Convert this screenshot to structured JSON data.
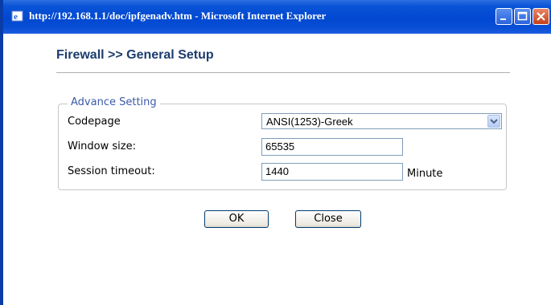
{
  "window": {
    "title": "http://192.168.1.1/doc/ipfgenadv.htm - Microsoft Internet Explorer",
    "icons": [
      "ie-icon",
      "minimize-icon",
      "maximize-icon",
      "close-icon"
    ]
  },
  "page": {
    "title": "Firewall >> General Setup"
  },
  "advance": {
    "legend": "Advance Setting",
    "codepage": {
      "label": "Codepage",
      "value": "ANSI(1253)-Greek"
    },
    "window_size": {
      "label": "Window size:",
      "value": "65535"
    },
    "session_timeout": {
      "label": "Session timeout:",
      "value": "1440",
      "unit": "Minute"
    }
  },
  "buttons": {
    "ok": "OK",
    "close": "Close"
  },
  "colors": {
    "title_bar": "#0048d0",
    "page_title": "#1c3c6e",
    "legend": "#3a5aa8"
  }
}
